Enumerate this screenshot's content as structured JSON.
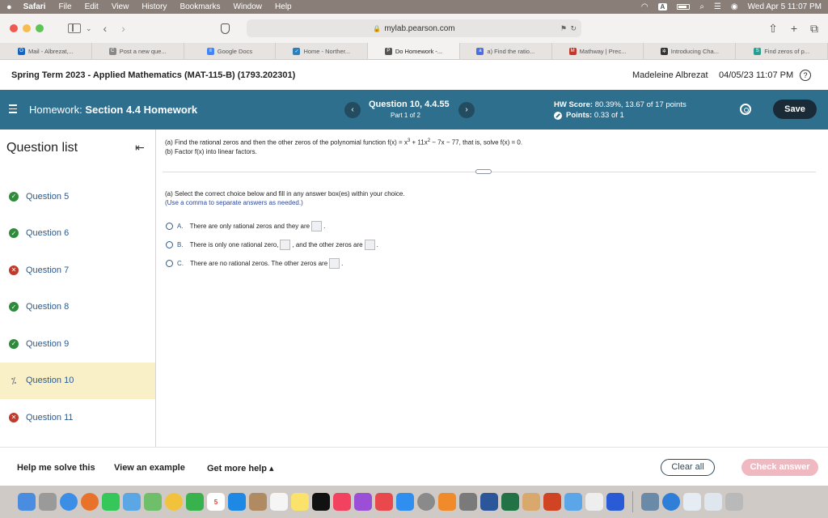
{
  "menubar": {
    "apple": "",
    "items": [
      "Safari",
      "File",
      "Edit",
      "View",
      "History",
      "Bookmarks",
      "Window",
      "Help"
    ],
    "input_badge": "A",
    "clock": "Wed Apr 5  11:07 PM"
  },
  "browser": {
    "url": "mylab.pearson.com",
    "tabs": [
      {
        "label": "Mail - Albrezat,...",
        "icon": "outlook-icon",
        "color": "#1565c0",
        "glyph": "O"
      },
      {
        "label": "Post a new que...",
        "icon": "chegg-icon",
        "color": "#888888",
        "glyph": "C"
      },
      {
        "label": "Google Docs",
        "icon": "docs-icon",
        "color": "#4285f4",
        "glyph": "≡"
      },
      {
        "label": "Home - Norther...",
        "icon": "northern-icon",
        "color": "#2c7fb8",
        "glyph": "✓"
      },
      {
        "label": "Do Homework -...",
        "icon": "pearson-icon",
        "color": "#555555",
        "glyph": "P"
      },
      {
        "label": "a) Find the ratio...",
        "icon": "quizlet-icon",
        "color": "#4b6ee0",
        "glyph": "a"
      },
      {
        "label": "Mathway | Prec...",
        "icon": "mathway-icon",
        "color": "#c0392b",
        "glyph": "M"
      },
      {
        "label": "Introducing Cha...",
        "icon": "openai-icon",
        "color": "#333333",
        "glyph": "✲"
      },
      {
        "label": "Find zeros of p...",
        "icon": "symbolab-icon",
        "color": "#2a9d8f",
        "glyph": "S"
      }
    ],
    "active_tab": 4
  },
  "course": {
    "title": "Spring Term 2023 - Applied Mathematics (MAT-115-B) (1793.202301)",
    "user": "Madeleine Albrezat",
    "date": "04/05/23 11:07 PM",
    "help": "?"
  },
  "homework": {
    "label": "Homework:",
    "name": "Section 4.4 Homework",
    "question": "Question 10, 4.4.55",
    "part": "Part 1 of 2",
    "hw_score_label": "HW Score:",
    "hw_score_value": "80.39%, 13.67 of 17 points",
    "points_label": "Points:",
    "points_value": "0.33 of 1",
    "save": "Save",
    "prev": "‹",
    "next": "›"
  },
  "question_list": {
    "title": "Question list",
    "items": [
      {
        "label": "Question 5",
        "status": "correct",
        "status_glyph": "✓"
      },
      {
        "label": "Question 6",
        "status": "correct",
        "status_glyph": "✓"
      },
      {
        "label": "Question 7",
        "status": "incorrect",
        "status_glyph": "✕"
      },
      {
        "label": "Question 8",
        "status": "correct",
        "status_glyph": "✓"
      },
      {
        "label": "Question 9",
        "status": "correct",
        "status_glyph": "✓"
      },
      {
        "label": "Question 10",
        "status": "partial",
        "status_glyph": "⁒"
      },
      {
        "label": "Question 11",
        "status": "incorrect",
        "status_glyph": "✕"
      }
    ],
    "current_index": 5
  },
  "problem": {
    "line_a_pre": "(a) Find the rational zeros and then the other zeros of the polynomial function f(x) = x",
    "exp1": "3",
    "line_a_mid": " + 11x",
    "exp2": "2",
    "line_a_post": " − 7x − 77, that is, solve f(x) = 0.",
    "line_b": "(b) Factor f(x) into linear factors.",
    "instruction": "(a) Select the correct choice below and fill in any answer box(es) within your choice.",
    "note": "(Use a comma to separate answers as needed.)",
    "choices": [
      {
        "letter": "A.",
        "text_pre": "There are only rational zeros and they are",
        "text_mid": "",
        "text_post": "."
      },
      {
        "letter": "B.",
        "text_pre": "There is only one rational zero,",
        "text_mid": ", and the other zeros are",
        "text_post": "."
      },
      {
        "letter": "C.",
        "text_pre": "There are no rational zeros. The other zeros are",
        "text_mid": "",
        "text_post": "."
      }
    ]
  },
  "actions": {
    "help_solve": "Help me solve this",
    "example": "View an example",
    "more_help": "Get more help ▴",
    "clear": "Clear all",
    "check": "Check answer"
  },
  "colors": {
    "hw_bar": "#2e6f8e",
    "current_item": "#faf0c8",
    "check_button": "#f0b9c1",
    "correct": "#2e8b3a",
    "incorrect": "#c0392b"
  }
}
